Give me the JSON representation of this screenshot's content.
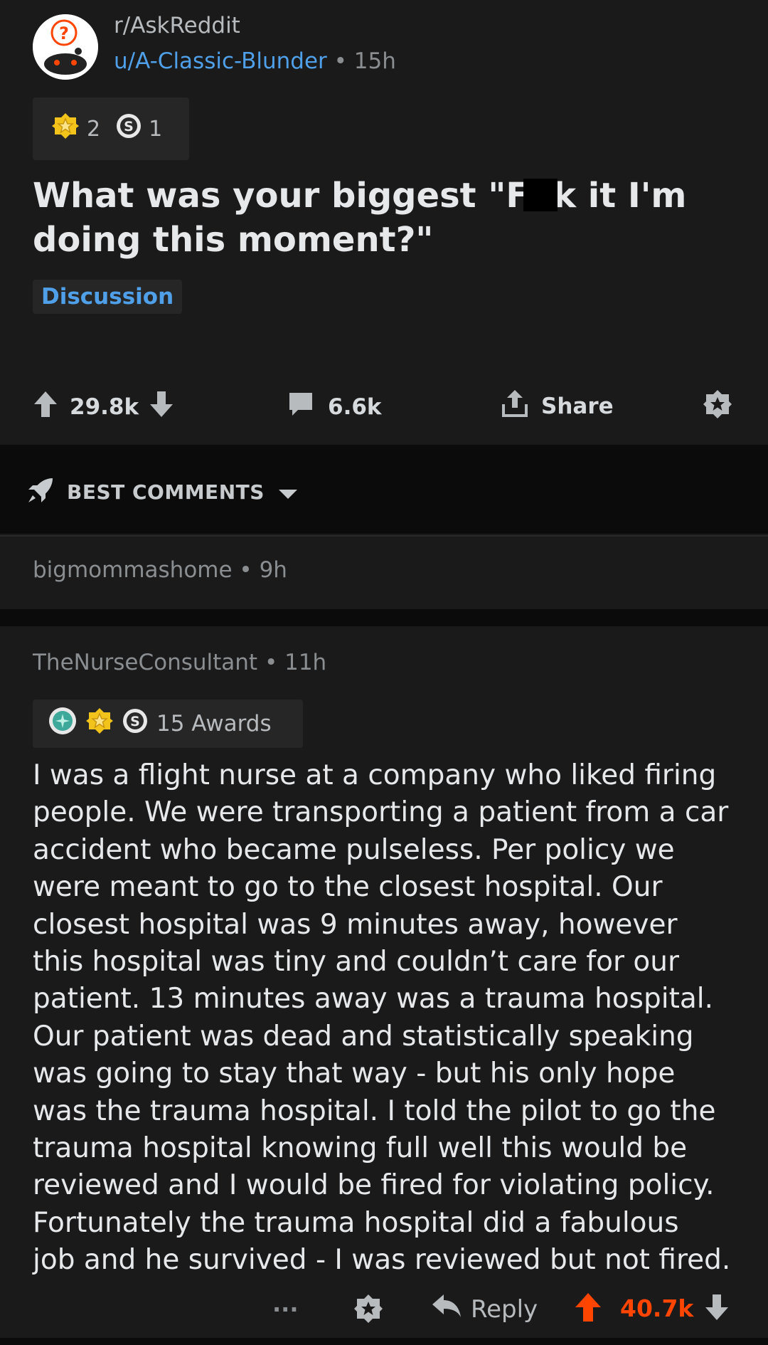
{
  "post": {
    "subreddit": "r/AskReddit",
    "author": "u/A-Classic-Blunder",
    "separator": "•",
    "age": "15h",
    "awards": {
      "gold_count": "2",
      "silver_count": "1"
    },
    "title_before": "What was your biggest \"F",
    "title_after": "k it I'm doing this moment?\"",
    "flair": "Discussion",
    "upvotes": "29.8k",
    "comments": "6.6k",
    "share_label": "Share"
  },
  "sort": {
    "label": "BEST COMMENTS"
  },
  "collapsed_comment": {
    "user": "bigmommashome",
    "separator": "•",
    "age": "9h"
  },
  "comment": {
    "user": "TheNurseConsultant",
    "separator": "•",
    "age": "11h",
    "awards_label": "15 Awards",
    "body": "I was a flight nurse at a company who liked firing\npeople. We were transporting a patient from a car\naccident who became pulseless. Per policy we\nwere meant to go to the closest hospital. Our\nclosest hospital was 9 minutes away, however\nthis hospital was tiny and couldn’t care for our\npatient. 13 minutes away was a trauma hospital.\nOur patient was dead and statistically speaking\nwas going to stay that way - but his only hope\nwas the trauma hospital. I told the pilot to go the\ntrauma hospital knowing full well this would be\nreviewed and I would be fired for violating policy.\nFortunately the trauma hospital did a fabulous\njob and he survived - I was reviewed but not fired.",
    "more_label": "...",
    "reply_label": "Reply",
    "score": "40.7k"
  },
  "colors": {
    "background": "#1a1a1b",
    "link_blue": "#4fa0e8",
    "upvote_orange": "#ff4500",
    "award_gold": "#f2c31b"
  }
}
